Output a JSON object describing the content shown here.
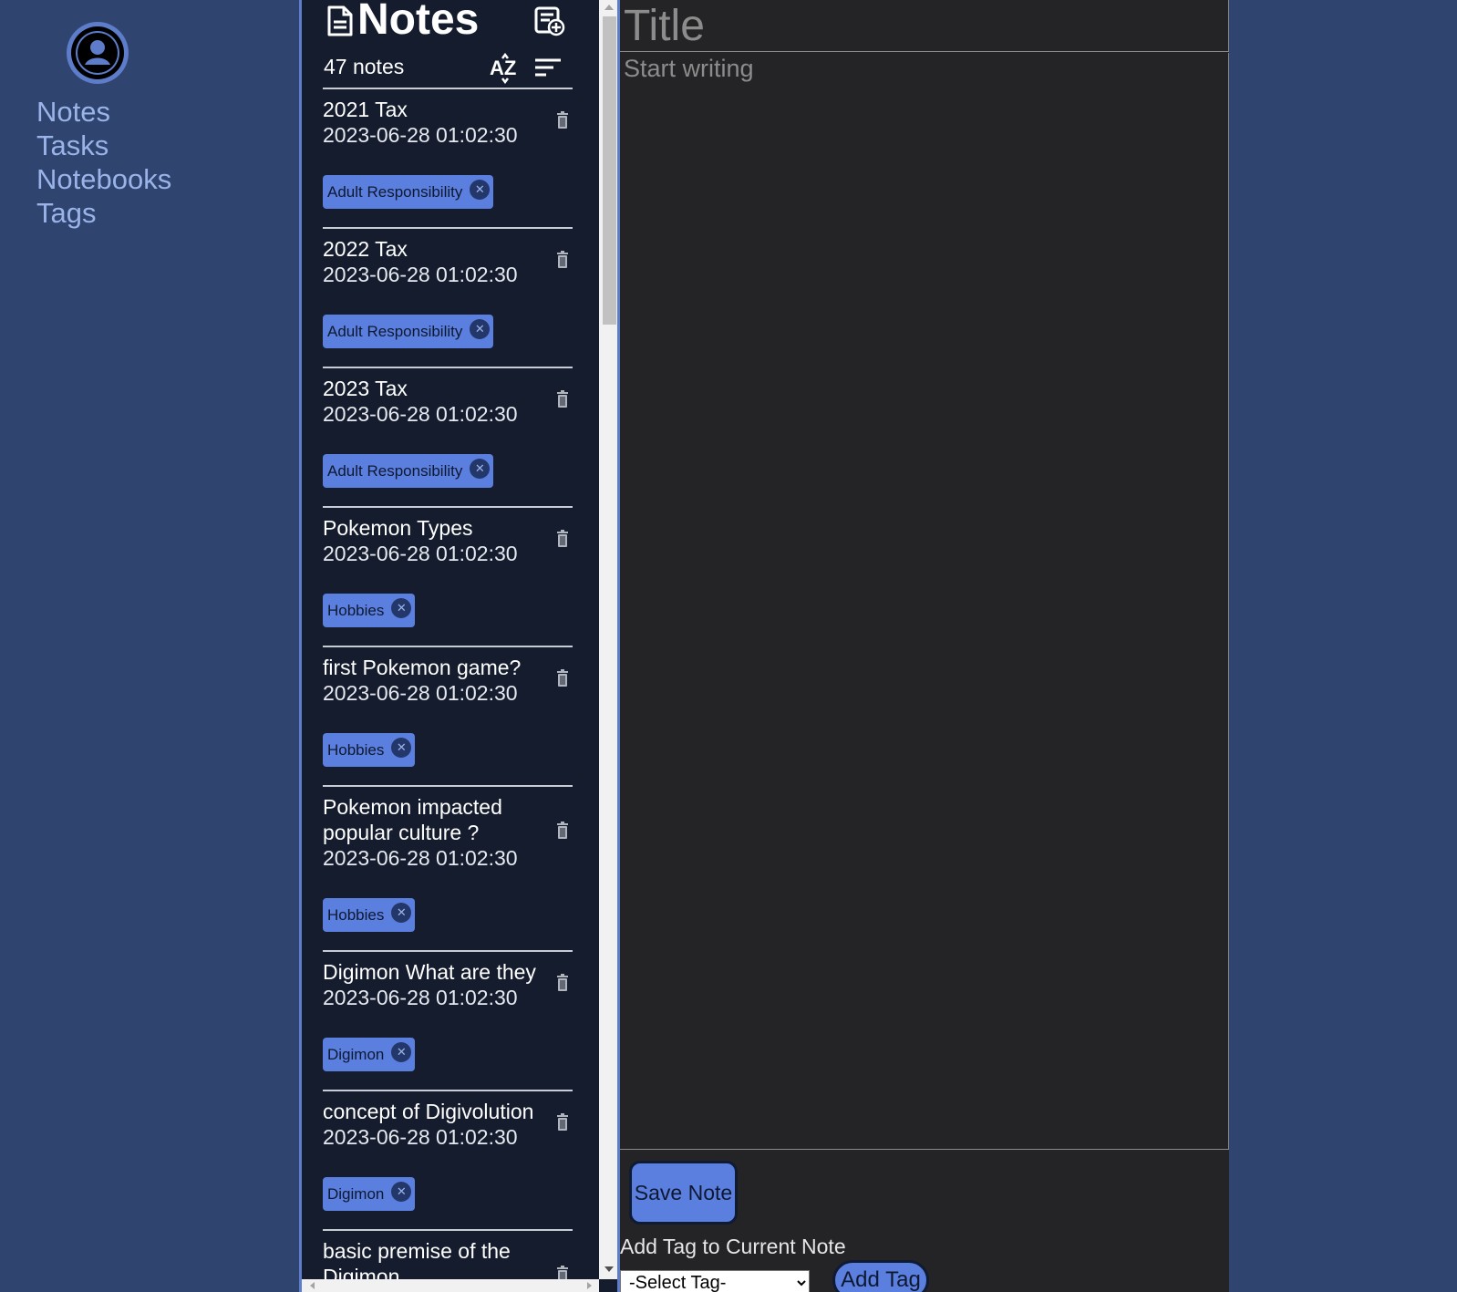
{
  "nav": {
    "links": [
      "Notes",
      "Tasks",
      "Notebooks",
      "Tags"
    ]
  },
  "notes_panel": {
    "heading": "Notes",
    "count": "47 notes",
    "sort_az_label": "AZ",
    "notes": [
      {
        "title": "2021 Tax",
        "date": "2023-06-28 01:02:30",
        "tag": "Adult Responsibility"
      },
      {
        "title": "2022 Tax",
        "date": "2023-06-28 01:02:30",
        "tag": "Adult Responsibility"
      },
      {
        "title": "2023 Tax",
        "date": "2023-06-28 01:02:30",
        "tag": "Adult Responsibility"
      },
      {
        "title": "Pokemon Types",
        "date": "2023-06-28 01:02:30",
        "tag": "Hobbies"
      },
      {
        "title": "first Pokemon game?",
        "date": "2023-06-28 01:02:30",
        "tag": "Hobbies"
      },
      {
        "title": "Pokemon impacted popular culture ?",
        "date": "2023-06-28 01:02:30",
        "tag": "Hobbies"
      },
      {
        "title": "Digimon What are they",
        "date": "2023-06-28 01:02:30",
        "tag": "Digimon"
      },
      {
        "title": "concept of Digivolution",
        "date": "2023-06-28 01:02:30",
        "tag": "Digimon"
      },
      {
        "title": "basic premise of the Digimon",
        "date": "",
        "tag": ""
      }
    ]
  },
  "editor": {
    "title_placeholder": "Title",
    "body_placeholder": "Start writing",
    "save_label": "Save Note",
    "add_tag_label": "Add Tag to Current Note",
    "select_placeholder": "-Select Tag-",
    "add_tag_button": "Add Tag"
  },
  "colors": {
    "background": "#2f4570",
    "panel": "#141c2e",
    "accent": "#5b7fde",
    "editor": "#242426",
    "nav_text": "#9ab3e8"
  },
  "icons": [
    "user-avatar-icon",
    "document-icon",
    "new-note-icon",
    "sort-az-icon",
    "sort-lines-icon",
    "trash-icon",
    "close-icon",
    "chevron-down-icon"
  ]
}
